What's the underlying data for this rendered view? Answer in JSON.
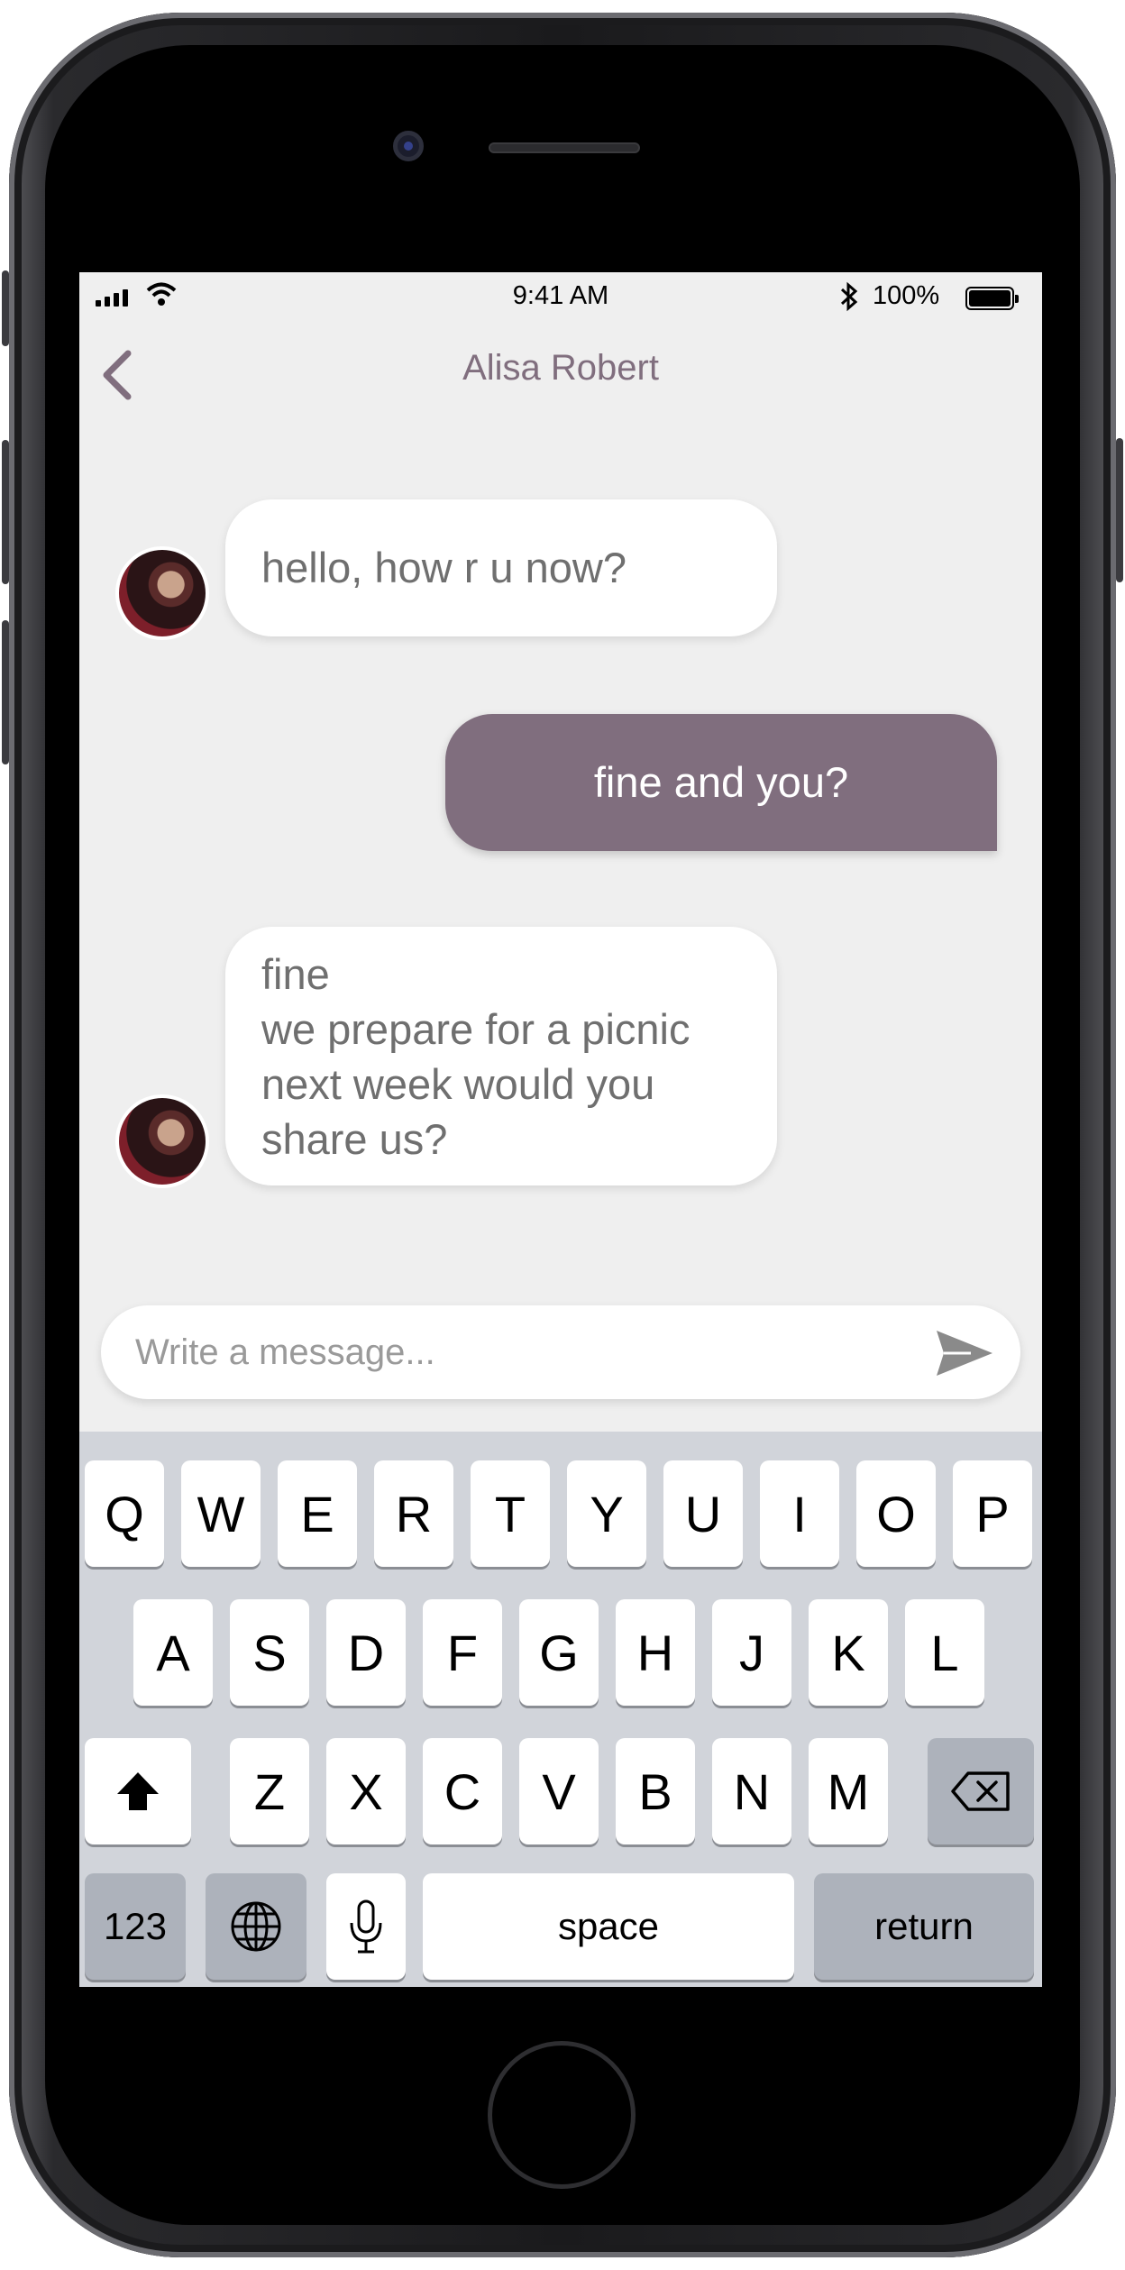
{
  "status_bar": {
    "time": "9:41 AM",
    "battery": "100%"
  },
  "nav": {
    "title": "Alisa Robert"
  },
  "messages": [
    {
      "from": "them",
      "text": "hello, how r u now?"
    },
    {
      "from": "me",
      "text": "fine and you?"
    },
    {
      "from": "them",
      "lines": [
        "fine",
        "we prepare for a picnic",
        "next week would you",
        "share us?"
      ]
    }
  ],
  "composer": {
    "placeholder": "Write a message..."
  },
  "keyboard": {
    "row1": [
      "Q",
      "W",
      "E",
      "R",
      "T",
      "Y",
      "U",
      "I",
      "O",
      "P"
    ],
    "row2": [
      "A",
      "S",
      "D",
      "F",
      "G",
      "H",
      "J",
      "K",
      "L"
    ],
    "row3": [
      "Z",
      "X",
      "C",
      "V",
      "B",
      "N",
      "M"
    ],
    "numbers": "123",
    "space": "space",
    "return": "return"
  },
  "icons": [
    "back-chevron-icon",
    "send-icon",
    "shift-icon",
    "backspace-icon",
    "globe-icon",
    "microphone-icon",
    "wifi-icon",
    "bluetooth-icon",
    "battery-icon",
    "cellular-signal-icon"
  ],
  "colors": {
    "accent": "#806e7e",
    "background": "#efefef",
    "keyboard": "#d1d4da"
  }
}
